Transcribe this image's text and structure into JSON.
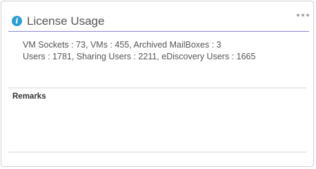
{
  "widget": {
    "title": "License Usage",
    "info_icon": "info-icon",
    "menu_icon": "more-horizontal-icon",
    "icon_color": "#2a9fd6",
    "accent_color": "#8b86d8"
  },
  "usage": {
    "line1": "VM Sockets : 73, VMs : 455, Archived MailBoxes : 3",
    "line2": "Users : 1781, Sharing Users : 2211, eDiscovery Users : 1665"
  },
  "remarks": {
    "label": "Remarks",
    "text": ""
  }
}
